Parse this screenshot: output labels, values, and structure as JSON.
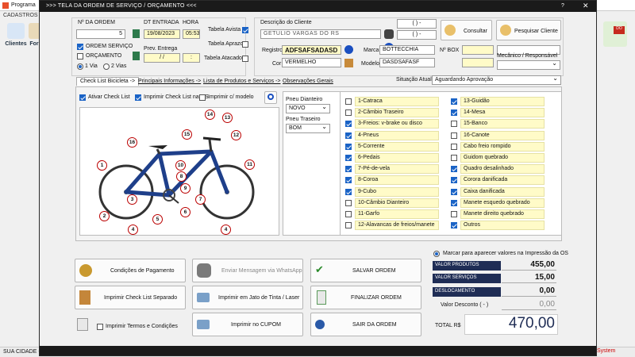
{
  "background_app": {
    "title": "Programa",
    "menu": "CADASTROS",
    "toolbar": [
      "Clientes",
      "For"
    ],
    "status_left": "SUA CIDADE -",
    "status_right": "System"
  },
  "window": {
    "title": ">>>   TELA DA ORDEM DE SERVIÇO / ORÇAMENTO   <<<",
    "help": "?",
    "close": "✕"
  },
  "order": {
    "num_label": "Nº DA ORDEM",
    "num_value": "5",
    "date_label": "DT ENTRADA",
    "date_value": "19/08/2023",
    "hour_label": "HORA",
    "hour_value": "05:53",
    "type_service": "ORDEM SERVIÇO",
    "type_budget": "ORÇAMENTO",
    "copies_1": "1 Via",
    "copies_2": "2 Vias",
    "delivery_label": "Prev. Entrega",
    "delivery_date": "  /  /",
    "delivery_hour": ":"
  },
  "price_tables": {
    "avista": "Tabela Avista",
    "aprazo": "Tabela Aprazo",
    "atacado": "Tabela Atacado"
  },
  "client": {
    "desc_label": "Descrição do Cliente",
    "name": "GETULIO VARGAS DO RS",
    "phone1": "(  )    -",
    "phone2": "(  )    -",
    "consult_btn": "Consultar",
    "search_btn": "Pesquisar Cliente",
    "registro_label": "Registro",
    "registro_value": "ADFSAFSADASD",
    "cor_label": "Cor",
    "cor_value": "VERMELHO",
    "marca_label": "Marca",
    "marca_value": "BOTTECCHIA",
    "modelo_label": "Modelo",
    "modelo_value": "DASDSAFASF",
    "box_label": "Nº BOX",
    "mechanic_label": "Mecânico / Responsável"
  },
  "tabs": [
    "Check List Bicicleta ->",
    "Principais Informações ->",
    "Lista de Produtos e Serviços ->",
    "Observações Gerais"
  ],
  "situation": {
    "label": "Situação Atual:",
    "value": "Aguardando Aprovação"
  },
  "checklist_options": {
    "activate": "Ativar Check List",
    "print_in_os": "Imprimir Check List na OS",
    "print_with_model": "Imprimir c/ modelo"
  },
  "tires": {
    "front_label": "Pneu Dianteiro",
    "front_value": "NOVO",
    "rear_label": "Pneu Traseiro",
    "rear_value": "BOM"
  },
  "bike_labels": [
    "1",
    "2",
    "3",
    "4",
    "4",
    "5",
    "6",
    "7",
    "8",
    "9",
    "10",
    "11",
    "12",
    "13",
    "14",
    "15",
    "16"
  ],
  "check_left": [
    {
      "label": "1-Catraca",
      "checked": false
    },
    {
      "label": "2-Câmbio Traseiro",
      "checked": false
    },
    {
      "label": "3-Freios: v-brake ou disco",
      "checked": true
    },
    {
      "label": "4-Pneus",
      "checked": true
    },
    {
      "label": "5-Corrente",
      "checked": true
    },
    {
      "label": "6-Pedais",
      "checked": true
    },
    {
      "label": "7-Pé-de-vela",
      "checked": true
    },
    {
      "label": "8-Coroa",
      "checked": true
    },
    {
      "label": "9-Cubo",
      "checked": true
    },
    {
      "label": "10-Câmbio Dianteiro",
      "checked": false
    },
    {
      "label": "11-Garfo",
      "checked": false
    },
    {
      "label": "12-Alavancas de freios/manete",
      "checked": false
    }
  ],
  "check_right": [
    {
      "label": "13-Guidão",
      "checked": true
    },
    {
      "label": "14-Mesa",
      "checked": true
    },
    {
      "label": "15-Banco",
      "checked": false
    },
    {
      "label": "16-Canote",
      "checked": false
    },
    {
      "label": "Cabo freio rompido",
      "checked": false
    },
    {
      "label": "Guidom quebrado",
      "checked": false
    },
    {
      "label": "Quadro desalinhado",
      "checked": true
    },
    {
      "label": "Corora danificada",
      "checked": true
    },
    {
      "label": "Caixa danificada",
      "checked": true
    },
    {
      "label": "Manete esquedo quebrado",
      "checked": true
    },
    {
      "label": "Manete direito quebrado",
      "checked": false
    },
    {
      "label": "Outros",
      "checked": true
    }
  ],
  "actions": {
    "payment": "Condições de Pagamento",
    "whatsapp": "Enviar Mensagem via WhatsApp",
    "save": "SALVAR ORDEM",
    "print_checklist": "Imprimir Check List Separado",
    "print_inkjet": "Imprimir em Jato de Tinta / Laser",
    "finish": "FINALIZAR ORDEM",
    "print_terms": "Imprimir Termos e Condições",
    "print_coupon": "Imprimir no CUPOM",
    "exit": "SAIR DA ORDEM"
  },
  "totals": {
    "mark_label": "Marcar para aparecer valores na Impressão da OS",
    "products_label": "VALOR PRODUTOS",
    "products_value": "455,00",
    "services_label": "VALOR SERVIÇOS",
    "services_value": "15,00",
    "travel_label": "DESLOCAMENTO",
    "travel_value": "0,00",
    "discount_label": "Valor Desconto ( - )",
    "discount_value": "0,00",
    "total_label": "TOTAL R$",
    "total_value": "470,00"
  },
  "colors": {
    "title_bar": "#1a1a1a",
    "accent_blue": "#1a63c6",
    "field_yellow": "#fffbc8",
    "total_navy": "#1f2d55",
    "bike_frame": "#1e3f8a"
  }
}
